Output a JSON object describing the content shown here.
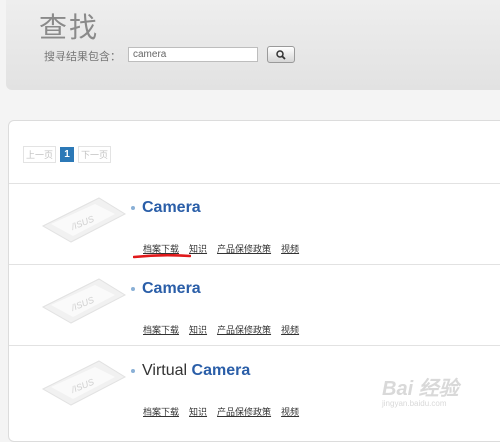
{
  "header": {
    "title": "查找",
    "search_label": "搜寻结果包含：",
    "search_value": "camera"
  },
  "pagination": {
    "prev": "上一页",
    "current": "1",
    "next": "下一页"
  },
  "results": [
    {
      "title_prefix": "",
      "title_highlight": "Camera",
      "links": [
        "档案下载",
        "知识",
        "产品保修政策",
        "视频"
      ]
    },
    {
      "title_prefix": "",
      "title_highlight": "Camera",
      "links": [
        "档案下载",
        "知识",
        "产品保修政策",
        "视频"
      ]
    },
    {
      "title_prefix": "Virtual ",
      "title_highlight": "Camera",
      "links": [
        "档案下载",
        "知识",
        "产品保修政策",
        "视频"
      ]
    }
  ],
  "thumbnail_brand": "/ISUS",
  "watermark": {
    "main": "Bai 经验",
    "sub": "jingyan.baidu.com"
  },
  "colors": {
    "accent": "#2c79b7",
    "highlight": "#2a5ea8",
    "annotation": "#e0191b"
  }
}
